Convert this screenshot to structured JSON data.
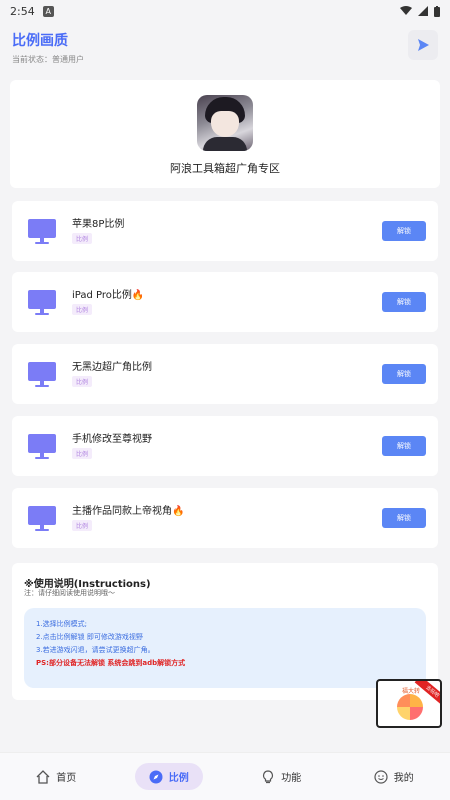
{
  "status_bar": {
    "time": "2:54",
    "notif": "A"
  },
  "header": {
    "title": "比例画质",
    "subtitle": "当前状态：普通用户"
  },
  "hero": {
    "title": "阿浪工具箱超广角专区"
  },
  "items": [
    {
      "title": "苹果8P比例",
      "tag": "比例",
      "button": "解锁"
    },
    {
      "title": "iPad Pro比例🔥",
      "tag": "比例",
      "button": "解锁"
    },
    {
      "title": "无黑边超广角比例",
      "tag": "比例",
      "button": "解锁"
    },
    {
      "title": "手机修改至尊视野",
      "tag": "比例",
      "button": "解锁"
    },
    {
      "title": "主播作品同款上帝视角🔥",
      "tag": "比例",
      "button": "解锁"
    }
  ],
  "instructions": {
    "title": "※使用说明(Instructions)",
    "note": "注：请仔细阅读使用说明哦～",
    "lines": [
      "1.选择比例模式;",
      "2.点击比例解锁 即可修改游戏视野",
      "3.若进游戏闪退，请尝试更换超广角。"
    ],
    "warning": "PS:部分设备无法解锁 系统会跳到adb解锁方式"
  },
  "promo": {
    "label": "福大转",
    "ribbon": "去玩吧"
  },
  "bottom_nav": [
    {
      "label": "首页",
      "active": false
    },
    {
      "label": "比例",
      "active": true
    },
    {
      "label": "功能",
      "active": false
    },
    {
      "label": "我的",
      "active": false
    }
  ],
  "colors": {
    "accent": "#4a6cf7",
    "button": "#5b86f5",
    "monitor": "#7b7cf6",
    "warning": "#e02424"
  }
}
